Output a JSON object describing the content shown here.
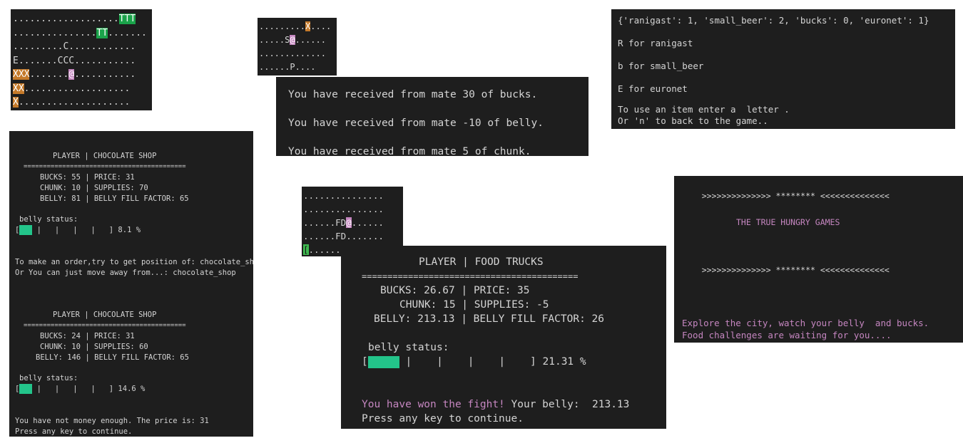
{
  "colors": {
    "terminal_bg": "#1e1e1e",
    "text": "#d4d4d4",
    "magenta": "#c586c0",
    "tree_green": "#1aa34a",
    "barrier_orange": "#c57a2a",
    "belly_bar_green": "#23c48a"
  },
  "map1": {
    "rows": [
      [
        {
          "t": "..................."
        },
        {
          "t": "TTT",
          "c": "tt"
        }
      ],
      [
        {
          "t": "..............."
        },
        {
          "t": "TT",
          "c": "tt"
        },
        {
          "t": "......."
        }
      ],
      [
        {
          "t": ".........C............"
        }
      ],
      [
        {
          "t": "E.......CCC..........."
        }
      ],
      [
        {
          "t": "XXX",
          "c": "xx"
        },
        {
          "t": "......."
        },
        {
          "t": "@",
          "c": "at"
        },
        {
          "t": "..........."
        }
      ],
      [
        {
          "t": "XX",
          "c": "xx"
        },
        {
          "t": "..................."
        }
      ],
      [
        {
          "t": "X",
          "c": "xx"
        },
        {
          "t": "...................."
        }
      ]
    ]
  },
  "map2": {
    "rows": [
      [
        {
          "t": "........."
        },
        {
          "t": "X",
          "c": "xx"
        },
        {
          "t": "...."
        }
      ],
      [
        {
          "t": ".....S"
        },
        {
          "t": "@",
          "c": "at"
        },
        {
          "t": "......"
        }
      ],
      [
        {
          "t": "............."
        }
      ],
      [
        {
          "t": "......P...."
        }
      ]
    ]
  },
  "map3": {
    "rows": [
      [
        {
          "t": "..............."
        }
      ],
      [
        {
          "t": "..............."
        }
      ],
      [
        {
          "t": "......FD"
        },
        {
          "t": "@",
          "c": "at"
        },
        {
          "t": "......"
        }
      ],
      [
        {
          "t": "......FD......."
        }
      ],
      [
        {
          "t": "[",
          "c": "cursor"
        },
        {
          "t": ".............."
        }
      ]
    ]
  },
  "mate": {
    "lines": [
      "You have received from mate 30 of bucks.",
      "You have received from mate -10 of belly.",
      "You have received from mate 5 of chunk."
    ]
  },
  "inventory": {
    "dict_line": "{'ranigast': 1, 'small_beer': 2, 'bucks': 0, 'euronet': 1}",
    "options": [
      "R for ranigast",
      "b for small_beer",
      "E for euronet"
    ],
    "prompt1": "To use an item enter a  letter .",
    "prompt2": "Or 'n' to back to the game.."
  },
  "shop": {
    "block1": {
      "header": "PLAYER | CHOCOLATE SHOP",
      "rule": "==========================================",
      "stats": [
        "BUCKS: 55 | PRICE: 31",
        "CHUNK: 10 | SUPPLIES: 70",
        "BELLY: 81 | BELLY FILL FACTOR: 65"
      ],
      "belly_label": "belly status:",
      "bar_open": "[",
      "bar_rest": " |   |   |   |   ] 8.1 %",
      "belly_pct": 8.1,
      "msg1": "To make an order,try to get position of: chocolate_shop",
      "msg2": "Or You can just move away from...: chocolate_shop"
    },
    "block2": {
      "header": "PLAYER | CHOCOLATE SHOP",
      "rule": "==========================================",
      "stats": [
        "BUCKS: 24 | PRICE: 31",
        "CHUNK: 10 | SUPPLIES: 60",
        "BELLY: 146 | BELLY FILL FACTOR: 65"
      ],
      "belly_label": "belly status:",
      "bar_open": "[",
      "bar_rest": " |   |   |   |   ] 14.6 %",
      "belly_pct": 14.6,
      "msg1": "You have not money enough. The price is: 31",
      "msg2": "Press any key to continue."
    }
  },
  "trucks": {
    "header": "PLAYER | FOOD TRUCKS",
    "rule": "==========================================",
    "stats": [
      "BUCKS: 26.67 | PRICE: 35",
      "CHUNK: 15 | SUPPLIES: -5",
      "BELLY: 213.13 | BELLY FILL FACTOR: 26"
    ],
    "belly_label": "belly status:",
    "bar_open": "[",
    "bar_rest": " |    |    |    |    ] 21.31 %",
    "belly_pct": 21.31,
    "won": "You have won the fight!",
    "your_belly": " Your belly:  213.13",
    "press": "Press any key to continue.",
    "cursor": "_"
  },
  "title_screen": {
    "banner": ">>>>>>>>>>>>>> ******** <<<<<<<<<<<<<<",
    "title": "THE TRUE HUNGRY GAMES",
    "banner2": ">>>>>>>>>>>>>> ******** <<<<<<<<<<<<<<",
    "line1": "Explore the city, watch your belly  and bucks.",
    "line2": "Food challenges are waiting for you...."
  }
}
